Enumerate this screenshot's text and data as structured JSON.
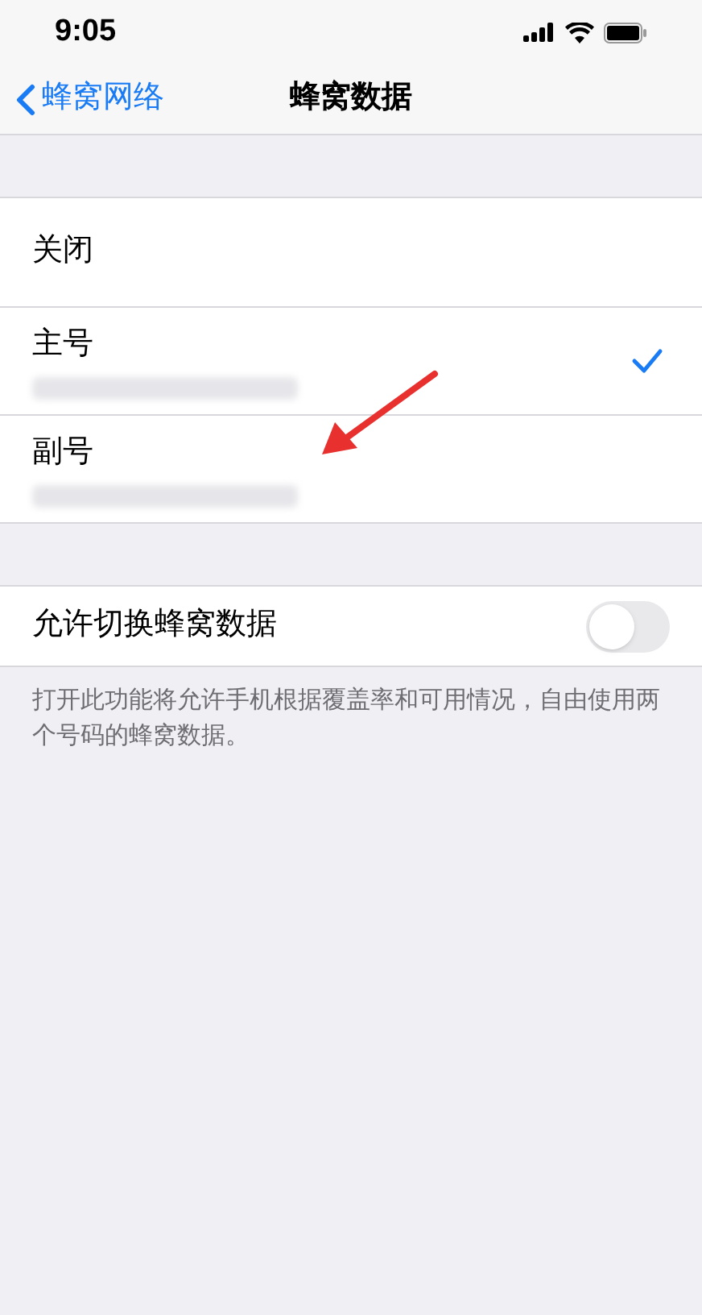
{
  "status_bar": {
    "time": "9:05"
  },
  "nav": {
    "back": "蜂窝网络",
    "title": "蜂窝数据"
  },
  "lines": [
    {
      "label": "关闭",
      "selected": false,
      "redacted": false
    },
    {
      "label": "主号",
      "selected": true,
      "redacted": true
    },
    {
      "label": "副号",
      "selected": false,
      "redacted": true
    }
  ],
  "switch_row": {
    "label": "允许切换蜂窝数据",
    "on": false
  },
  "footer": "打开此功能将允许手机根据覆盖率和可用情况，自由使用两个号码的蜂窝数据。"
}
